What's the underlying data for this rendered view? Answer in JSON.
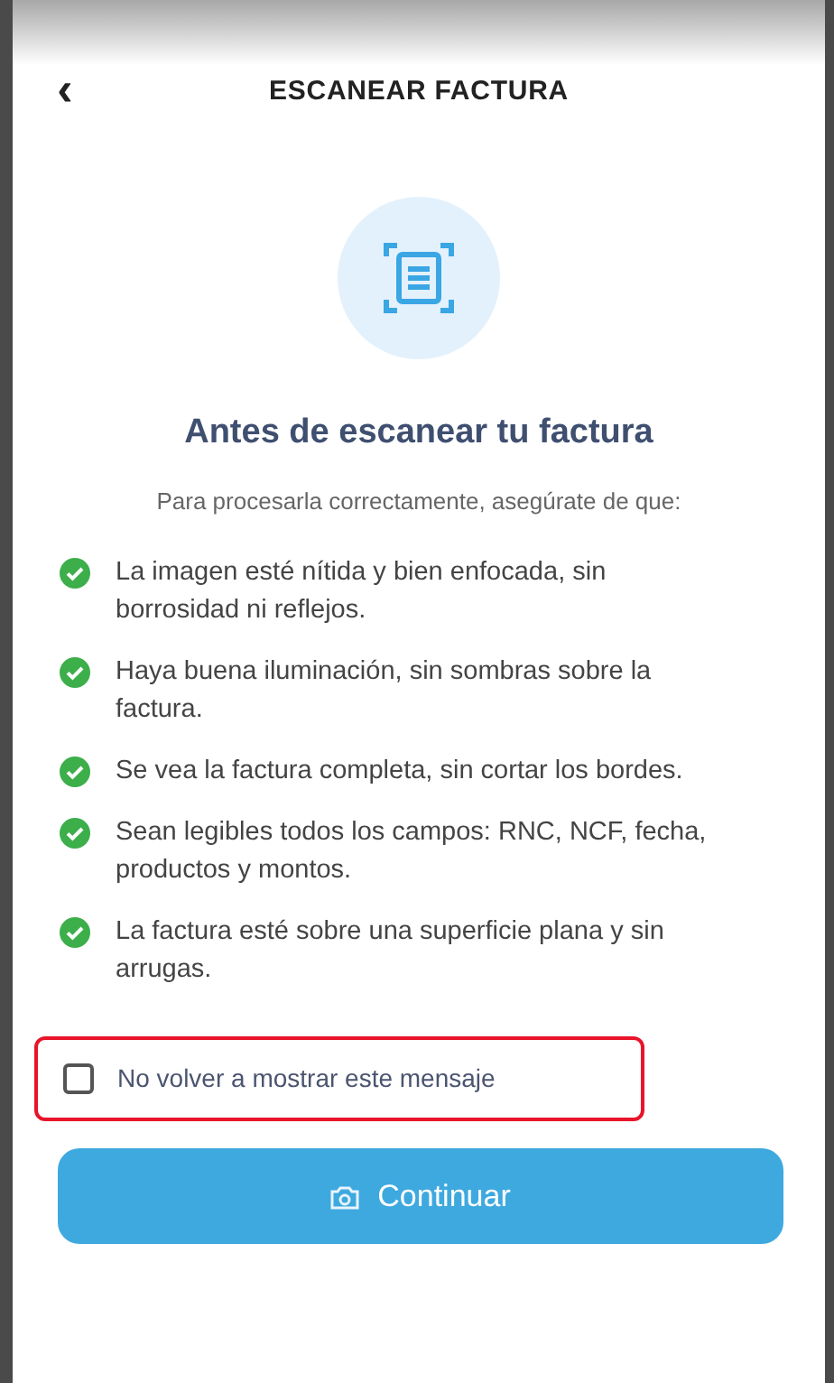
{
  "header": {
    "back": "‹",
    "title": "ESCANEAR FACTURA"
  },
  "heading": "Antes de escanear tu factura",
  "subtitle": "Para procesarla correctamente, asegúrate de que:",
  "checklist": [
    {
      "text": "La imagen esté nítida y bien enfocada, sin borrosidad ni reflejos."
    },
    {
      "text": "Haya buena iluminación, sin sombras sobre la factura."
    },
    {
      "text": "Se vea la factura completa, sin cortar los bordes."
    },
    {
      "text": "Sean legibles todos los campos: RNC, NCF, fecha, productos y montos."
    },
    {
      "text": "La factura esté sobre una superficie plana y sin arrugas."
    }
  ],
  "dont_show_again": {
    "label": "No volver a mostrar este mensaje",
    "checked": false
  },
  "continue_button": "Continuar"
}
